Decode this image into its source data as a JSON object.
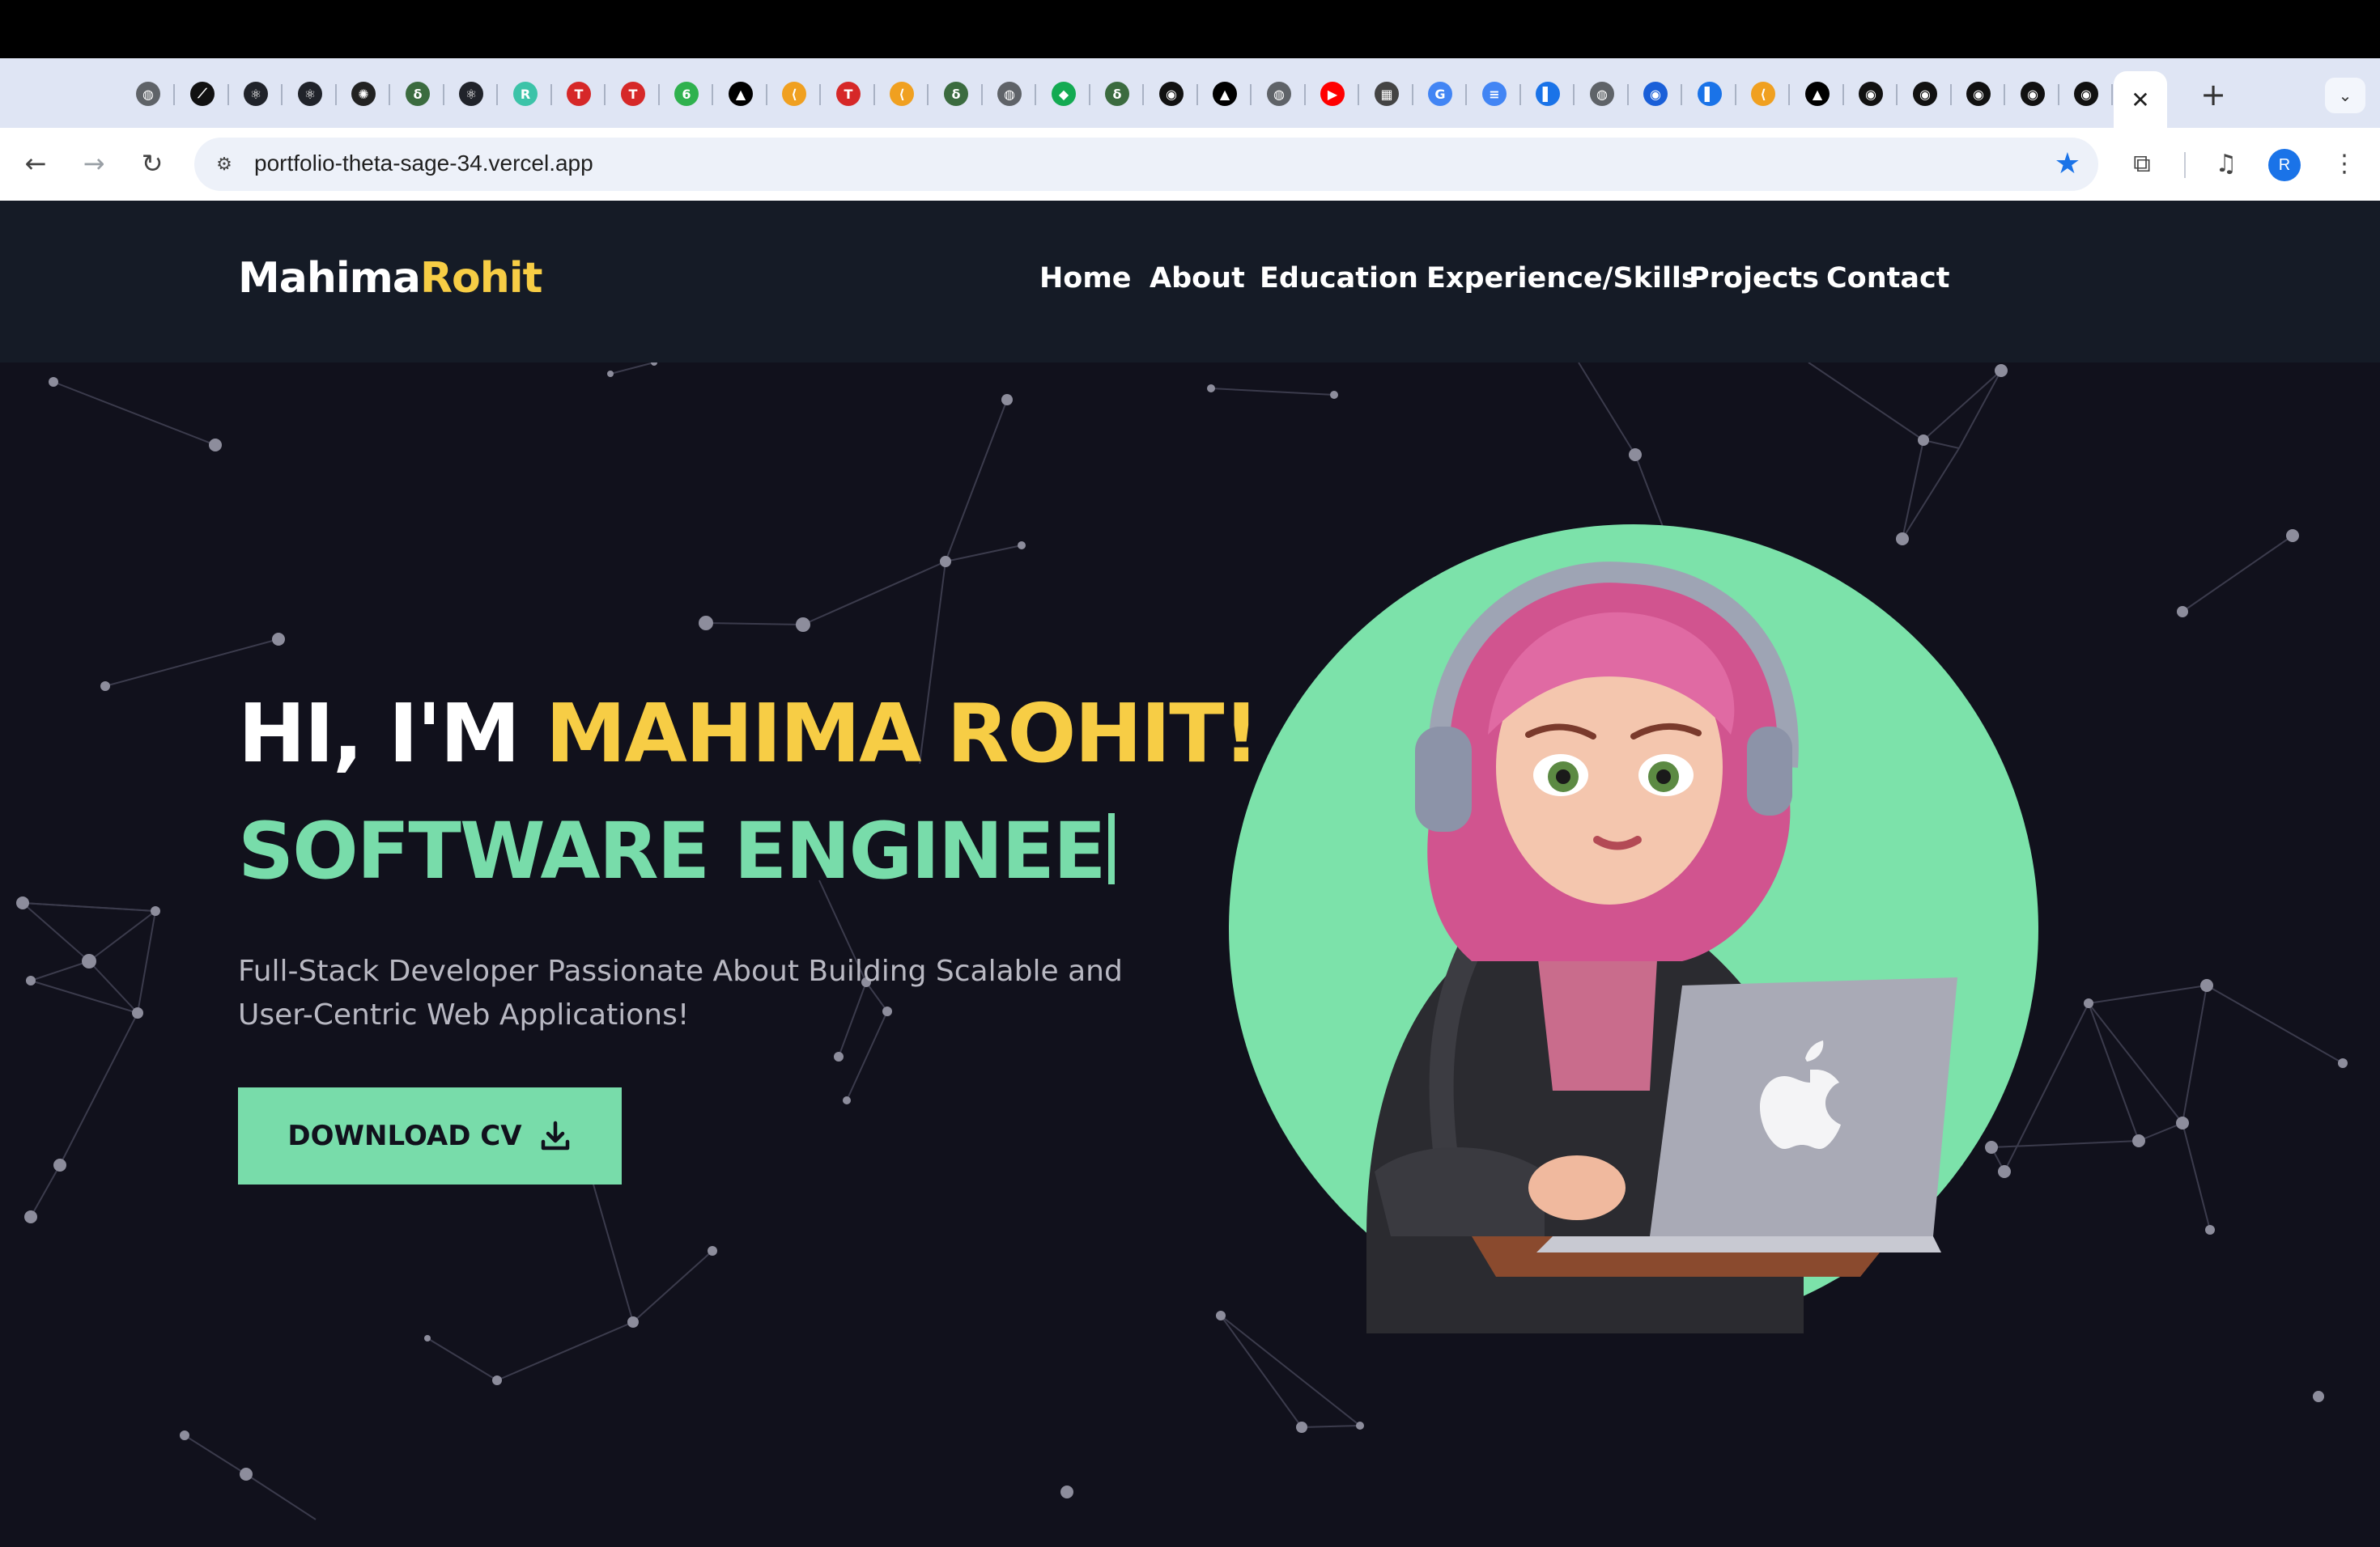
{
  "browser": {
    "tabs": [
      {
        "icon": "globe-icon",
        "color": "#5f6368",
        "glyph": "◍"
      },
      {
        "icon": "link-icon",
        "color": "#111111",
        "glyph": "⟋"
      },
      {
        "icon": "react-icon",
        "color": "#20232a",
        "glyph": "⚛"
      },
      {
        "icon": "react-icon",
        "color": "#20232a",
        "glyph": "⚛"
      },
      {
        "icon": "openai-icon",
        "color": "#222222",
        "glyph": "✺"
      },
      {
        "icon": "wodo-icon",
        "color": "#3b6b3f",
        "glyph": "δ"
      },
      {
        "icon": "react-icon",
        "color": "#20232a",
        "glyph": "⚛"
      },
      {
        "icon": "replit-r-icon",
        "color": "#3cc3a8",
        "glyph": "R"
      },
      {
        "icon": "tuf-icon",
        "color": "#d62828",
        "glyph": "T"
      },
      {
        "icon": "tuf-icon",
        "color": "#d62828",
        "glyph": "T"
      },
      {
        "icon": "badge-69-icon",
        "color": "#2fb14e",
        "glyph": "6"
      },
      {
        "icon": "vercel-icon",
        "color": "#000000",
        "glyph": "▲"
      },
      {
        "icon": "leetcode-icon",
        "color": "#f0a020",
        "glyph": "⟨"
      },
      {
        "icon": "tuf-icon",
        "color": "#d62828",
        "glyph": "T"
      },
      {
        "icon": "leetcode-icon",
        "color": "#f0a020",
        "glyph": "⟨"
      },
      {
        "icon": "wodo-icon",
        "color": "#3b6b3f",
        "glyph": "δ"
      },
      {
        "icon": "globe-icon",
        "color": "#5f6368",
        "glyph": "◍"
      },
      {
        "icon": "mongodb-icon",
        "color": "#13aa52",
        "glyph": "◆"
      },
      {
        "icon": "wodo-icon",
        "color": "#3b6b3f",
        "glyph": "δ"
      },
      {
        "icon": "github-icon",
        "color": "#111111",
        "glyph": "◉"
      },
      {
        "icon": "vercel-icon",
        "color": "#000000",
        "glyph": "▲"
      },
      {
        "icon": "globe-icon",
        "color": "#5f6368",
        "glyph": "◍"
      },
      {
        "icon": "youtube-icon",
        "color": "#ff0000",
        "glyph": "▶"
      },
      {
        "icon": "grid-icon",
        "color": "#444444",
        "glyph": "▦"
      },
      {
        "icon": "google-icon",
        "color": "#4285f4",
        "glyph": "G"
      },
      {
        "icon": "docs-icon",
        "color": "#4285f4",
        "glyph": "≡"
      },
      {
        "icon": "sidebar-icon",
        "color": "#1a73e8",
        "glyph": "▌"
      },
      {
        "icon": "globe-icon",
        "color": "#5f6368",
        "glyph": "◍"
      },
      {
        "icon": "circle-icon",
        "color": "#1a5fd8",
        "glyph": "◉"
      },
      {
        "icon": "sidebar-icon",
        "color": "#1a73e8",
        "glyph": "▌"
      },
      {
        "icon": "leetcode-icon",
        "color": "#f0a020",
        "glyph": "⟨"
      },
      {
        "icon": "vercel-icon",
        "color": "#000000",
        "glyph": "▲"
      },
      {
        "icon": "github-icon",
        "color": "#111111",
        "glyph": "◉"
      },
      {
        "icon": "github-icon",
        "color": "#111111",
        "glyph": "◉"
      },
      {
        "icon": "github-icon",
        "color": "#111111",
        "glyph": "◉"
      },
      {
        "icon": "github-icon",
        "color": "#111111",
        "glyph": "◉"
      },
      {
        "icon": "github-icon",
        "color": "#111111",
        "glyph": "◉"
      }
    ],
    "active_tab_close": "✕",
    "new_tab": "+",
    "tab_menu": "⌄",
    "url": "portfolio-theta-sage-34.vercel.app",
    "profile_initial": "R"
  },
  "site": {
    "logo_first": "Mahima",
    "logo_second": "Rohit",
    "nav": [
      "Home",
      "About",
      "Education",
      "Experience/Skills",
      "Projects",
      "Contact"
    ],
    "hero_greeting": "HI, I'M ",
    "hero_name": "MAHIMA ROHIT!",
    "hero_role": "SOFTWARE ENGINEE",
    "hero_description": "Full-Stack Developer Passionate About Building Scalable and User-Centric Web Applications!",
    "cv_button": "DOWNLOAD CV",
    "colors": {
      "accent_yellow": "#f7cd45",
      "accent_green": "#78dcaa",
      "background": "#11111c",
      "nav_background": "#151b26"
    }
  }
}
